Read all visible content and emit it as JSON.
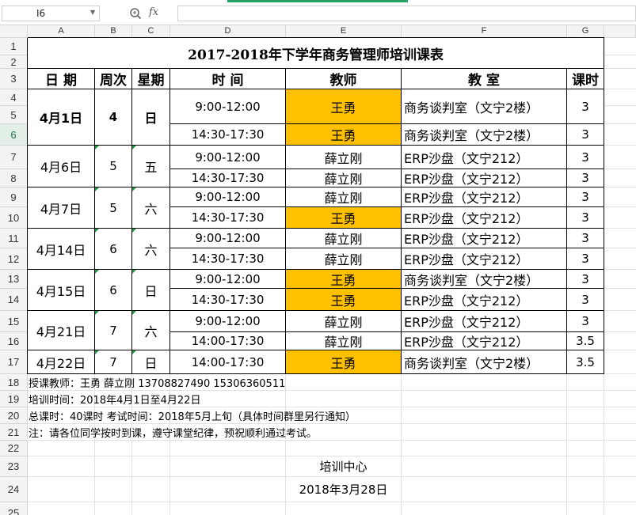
{
  "formula_bar": {
    "cell_ref": "I6",
    "formula_value": ""
  },
  "columns": [
    "A",
    "B",
    "C",
    "D",
    "E",
    "F",
    "G"
  ],
  "rows": [
    "1",
    "2",
    "3",
    "4",
    "5",
    "6",
    "7",
    "8",
    "9",
    "10",
    "11",
    "12",
    "13",
    "14",
    "15",
    "16",
    "17",
    "18",
    "19",
    "20",
    "21",
    "22",
    "23",
    "24",
    "25"
  ],
  "selected_row": "6",
  "sheet": {
    "title": "2017-2018年下学年商务管理师培训课表",
    "headers": {
      "date": "日  期",
      "week": "周次",
      "weekday": "星期",
      "time": "时      间",
      "teacher": "教师",
      "room": "教    室",
      "hours": "课时"
    },
    "groups": [
      {
        "date": "4月1日",
        "week": "4",
        "weekday": "日",
        "bold": true,
        "sessions": [
          {
            "time": "9:00-12:00",
            "teacher": "王勇",
            "room": "商务谈判室（文宁2楼）",
            "hours": "3",
            "highlight": true
          },
          {
            "time": "14:30-17:30",
            "teacher": "王勇",
            "room": "商务谈判室（文宁2楼）",
            "hours": "3",
            "highlight": true
          }
        ]
      },
      {
        "date": "4月6日",
        "week": "5",
        "weekday": "五",
        "bold": false,
        "sessions": [
          {
            "time": "9:00-12:00",
            "teacher": "薛立刚",
            "room": "ERP沙盘（文宁212）",
            "hours": "3",
            "highlight": false
          },
          {
            "time": "14:30-17:30",
            "teacher": "薛立刚",
            "room": "ERP沙盘（文宁212）",
            "hours": "3",
            "highlight": false
          }
        ]
      },
      {
        "date": "4月7日",
        "week": "5",
        "weekday": "六",
        "bold": false,
        "sessions": [
          {
            "time": "9:00-12:00",
            "teacher": "薛立刚",
            "room": "ERP沙盘（文宁212）",
            "hours": "3",
            "highlight": false
          },
          {
            "time": "14:30-17:30",
            "teacher": "王勇",
            "room": "ERP沙盘（文宁212）",
            "hours": "3",
            "highlight": true
          }
        ]
      },
      {
        "date": "4月14日",
        "week": "6",
        "weekday": "六",
        "bold": false,
        "sessions": [
          {
            "time": "9:00-12:00",
            "teacher": "薛立刚",
            "room": "ERP沙盘（文宁212）",
            "hours": "3",
            "highlight": false
          },
          {
            "time": "14:30-17:30",
            "teacher": "薛立刚",
            "room": "ERP沙盘（文宁212）",
            "hours": "3",
            "highlight": false
          }
        ]
      },
      {
        "date": "4月15日",
        "week": "6",
        "weekday": "日",
        "bold": false,
        "sessions": [
          {
            "time": "9:00-12:00",
            "teacher": "王勇",
            "room": "商务谈判室（文宁2楼）",
            "hours": "3",
            "highlight": true
          },
          {
            "time": "14:30-17:30",
            "teacher": "王勇",
            "room": "ERP沙盘（文宁212）",
            "hours": "3",
            "highlight": true
          }
        ]
      },
      {
        "date": "4月21日",
        "week": "7",
        "weekday": "六",
        "bold": false,
        "sessions": [
          {
            "time": "9:00-12:00",
            "teacher": "薛立刚",
            "room": "ERP沙盘（文宁212）",
            "hours": "3",
            "highlight": false
          },
          {
            "time": "14:00-17:30",
            "teacher": "薛立刚",
            "room": "ERP沙盘（文宁212）",
            "hours": "3.5",
            "highlight": false
          }
        ]
      },
      {
        "date": "4月22日",
        "week": "7",
        "weekday": "日",
        "bold": false,
        "sessions": [
          {
            "time": "14:00-17:30",
            "teacher": "王勇",
            "room": "商务谈判室（文宁2楼）",
            "hours": "3.5",
            "highlight": true
          }
        ]
      }
    ],
    "notes": [
      "授课教师：王勇 薛立刚    13708827490    15306360511",
      "培训时间：2018年4月1日至4月22日",
      "总课时：40课时    考试时间：2018年5月上旬（具体时间群里另行通知）",
      "注：请各位同学按时到课，遵守课堂纪律，预祝顺利通过考试。"
    ],
    "footer": {
      "org": "培训中心",
      "date": "2018年3月28日"
    }
  },
  "colors": {
    "highlight": "#ffc000",
    "accent": "#21a366",
    "header_bg": "#f3f3f3",
    "gridline": "#e1e1e1"
  },
  "icons": {
    "zoom": "magnifier-icon",
    "fx": "fx-icon",
    "dropdown": "chevron-down-icon"
  }
}
